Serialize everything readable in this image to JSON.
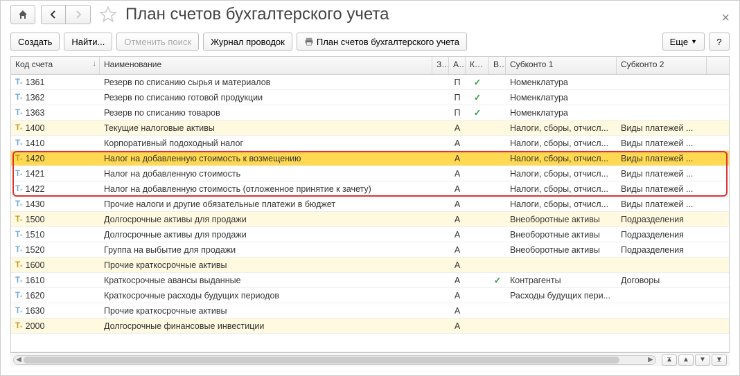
{
  "title": "План счетов бухгалтерского учета",
  "toolbar": {
    "create": "Создать",
    "find": "Найти...",
    "cancel_search": "Отменить поиск",
    "journal": "Журнал проводок",
    "print_chart": "План счетов бухгалтерского учета",
    "more": "Еще",
    "help": "?"
  },
  "columns": {
    "code": "Код счета",
    "name": "Наименование",
    "z": "З...",
    "a": "А...",
    "kol": "Кол.",
    "v": "В.",
    "sub1": "Субконто 1",
    "sub2": "Субконто 2"
  },
  "rows": [
    {
      "code": "1361",
      "name": "Резерв по списанию сырья и материалов",
      "a": "П",
      "kol": true,
      "sub1": "Номенклатура",
      "sub2": "",
      "level": "child"
    },
    {
      "code": "1362",
      "name": "Резерв по списанию готовой продукции",
      "a": "П",
      "kol": true,
      "sub1": "Номенклатура",
      "sub2": "",
      "level": "child"
    },
    {
      "code": "1363",
      "name": "Резерв по списанию товаров",
      "a": "П",
      "kol": true,
      "sub1": "Номенклатура",
      "sub2": "",
      "level": "child"
    },
    {
      "code": "1400",
      "name": "Текущие налоговые активы",
      "a": "А",
      "kol": false,
      "sub1": "Налоги, сборы, отчисл...",
      "sub2": "Виды платежей ...",
      "level": "parent"
    },
    {
      "code": "1410",
      "name": "Корпоративный подоходный налог",
      "a": "А",
      "kol": false,
      "sub1": "Налоги, сборы, отчисл...",
      "sub2": "Виды платежей ...",
      "level": "child"
    },
    {
      "code": "1420",
      "name": "Налог на добавленную стоимость к возмещению",
      "a": "А",
      "kol": false,
      "sub1": "Налоги, сборы, отчисл...",
      "sub2": "Виды платежей ...",
      "level": "parent",
      "selected": true,
      "group": true
    },
    {
      "code": "1421",
      "name": "Налог на добавленную стоимость",
      "a": "А",
      "kol": false,
      "sub1": "Налоги, сборы, отчисл...",
      "sub2": "Виды платежей ...",
      "level": "child",
      "group": true
    },
    {
      "code": "1422",
      "name": "Налог на добавленную стоимость (отложенное принятие к зачету)",
      "a": "А",
      "kol": false,
      "sub1": "Налоги, сборы, отчисл...",
      "sub2": "Виды платежей ...",
      "level": "child",
      "group": true
    },
    {
      "code": "1430",
      "name": "Прочие налоги и другие обязательные платежи в бюджет",
      "a": "А",
      "kol": false,
      "sub1": "Налоги, сборы, отчисл...",
      "sub2": "Виды платежей ...",
      "level": "child"
    },
    {
      "code": "1500",
      "name": "Долгосрочные активы для продажи",
      "a": "А",
      "kol": false,
      "sub1": "Внеоборотные активы",
      "sub2": "Подразделения",
      "level": "parent"
    },
    {
      "code": "1510",
      "name": "Долгосрочные активы для продажи",
      "a": "А",
      "kol": false,
      "sub1": "Внеоборотные активы",
      "sub2": "Подразделения",
      "level": "child"
    },
    {
      "code": "1520",
      "name": "Группа на выбытие для продажи",
      "a": "А",
      "kol": false,
      "sub1": "Внеоборотные активы",
      "sub2": "Подразделения",
      "level": "child"
    },
    {
      "code": "1600",
      "name": "Прочие краткосрочные активы",
      "a": "А",
      "kol": false,
      "sub1": "",
      "sub2": "",
      "level": "parent"
    },
    {
      "code": "1610",
      "name": "Краткосрочные авансы выданные",
      "a": "А",
      "kol": false,
      "v": true,
      "sub1": "Контрагенты",
      "sub2": "Договоры",
      "level": "child"
    },
    {
      "code": "1620",
      "name": "Краткосрочные расходы будущих периодов",
      "a": "А",
      "kol": false,
      "sub1": "Расходы будущих пери...",
      "sub2": "",
      "level": "child"
    },
    {
      "code": "1630",
      "name": "Прочие краткосрочные активы",
      "a": "А",
      "kol": false,
      "sub1": "",
      "sub2": "",
      "level": "child"
    },
    {
      "code": "2000",
      "name": "Долгосрочные финансовые инвестиции",
      "a": "А",
      "kol": false,
      "sub1": "",
      "sub2": "",
      "level": "parent"
    }
  ]
}
